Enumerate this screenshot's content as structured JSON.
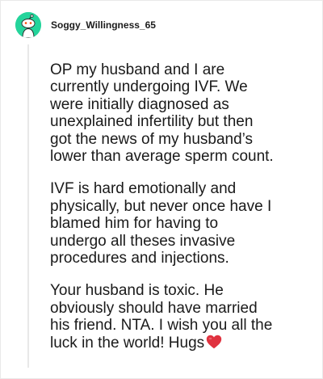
{
  "comment": {
    "username": "Soggy_Willingness_65",
    "paragraphs": [
      {
        "lines": [
          "OP my husband and I are",
          "currently undergoing IVF. We",
          "were initially diagnosed as",
          "unexplained infertility but then",
          "got the news of my husband’s",
          "lower than average sperm count."
        ]
      },
      {
        "lines": [
          "IVF is hard emotionally and",
          "physically, but never once have I",
          "blamed him for having to",
          "undergo all theses invasive",
          "procedures and injections."
        ]
      },
      {
        "lines": [
          "Your husband is toxic. He",
          "obviously should have married",
          "his friend. NTA. I wish you all the",
          "luck in the world! Hugs"
        ]
      }
    ],
    "trailing_emoji": "heart-emoji",
    "colors": {
      "avatar_bg": "#24d49b",
      "heart": "#e0323f",
      "thread_line": "#e8e8e8"
    }
  }
}
